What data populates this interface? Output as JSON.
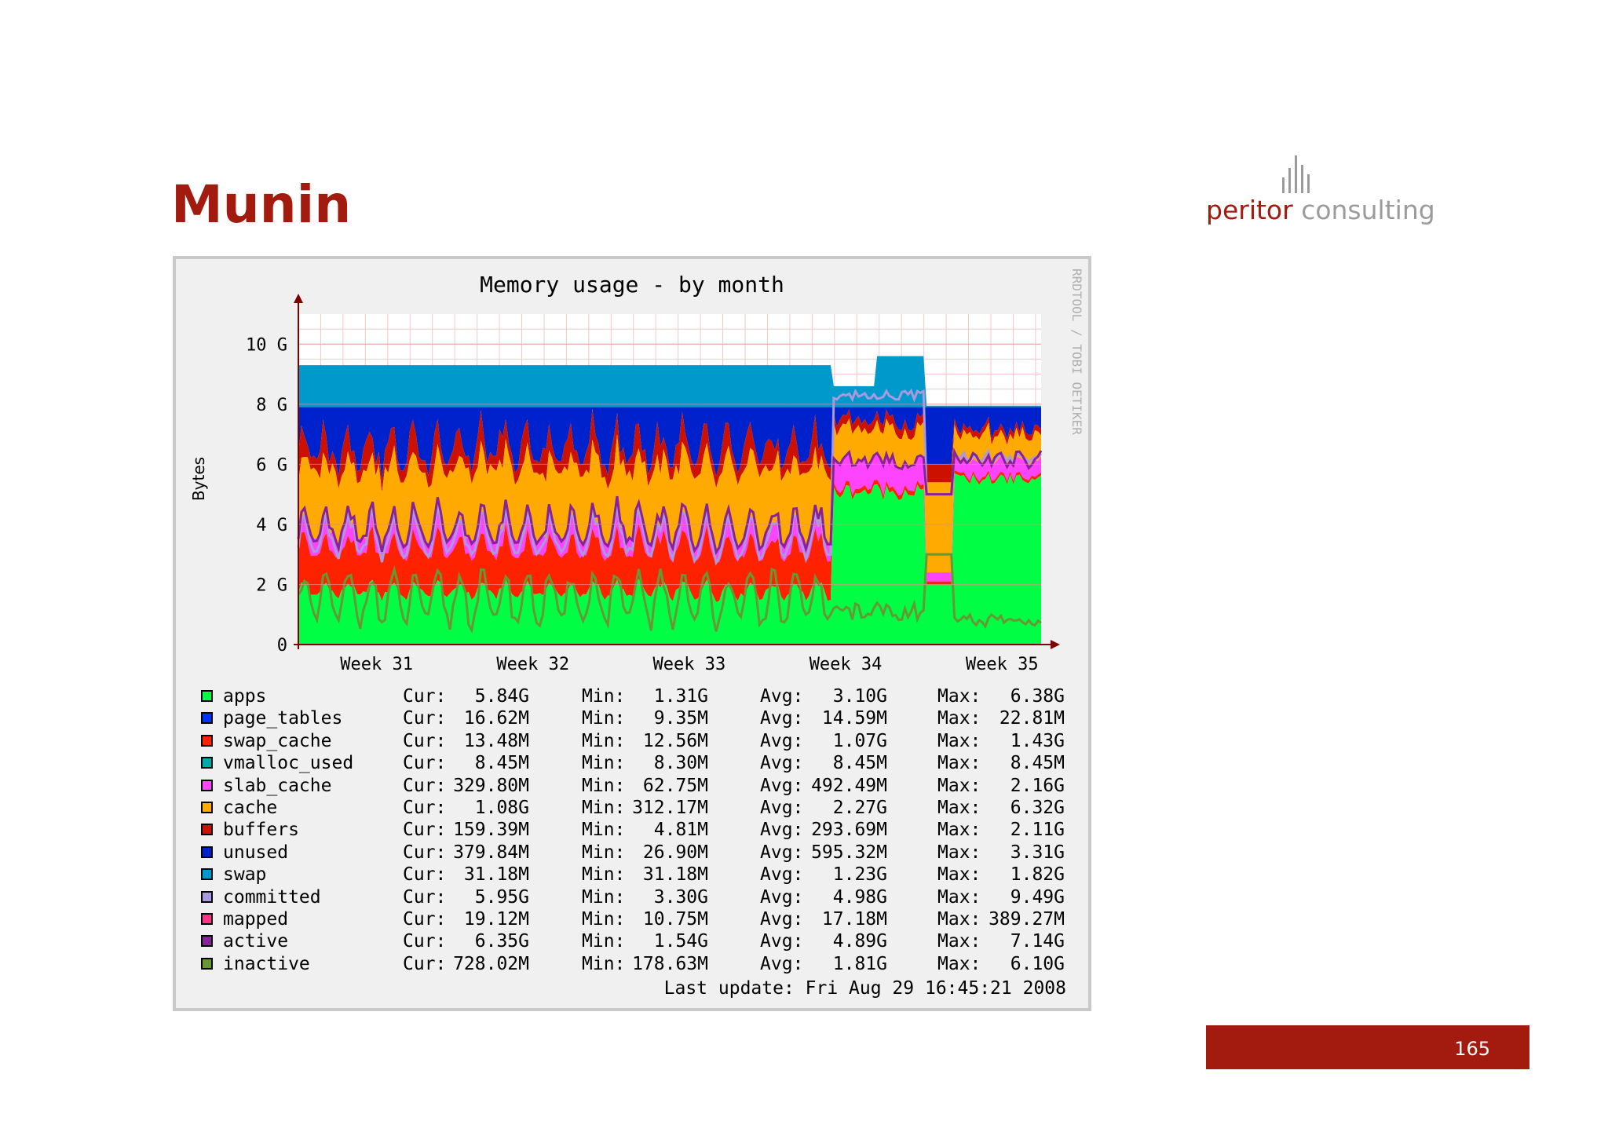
{
  "slide": {
    "title": "Munin",
    "logo": {
      "word1": "peritor",
      "word2": "consulting"
    },
    "page_number": "165"
  },
  "chart_data": {
    "type": "area",
    "title": "Memory usage - by month",
    "ylabel": "Bytes",
    "watermark": "RRDTOOL / TOBI OETIKER",
    "x_ticks": [
      "Week 31",
      "Week 32",
      "Week 33",
      "Week 34",
      "Week 35"
    ],
    "y_ticks": [
      "0",
      "2 G",
      "4 G",
      "6 G",
      "8 G",
      "10 G"
    ],
    "ylim_gb": [
      0,
      11
    ],
    "grid": true,
    "series": [
      {
        "name": "apps",
        "color": "#00ff44",
        "cur": "5.84G",
        "min": "1.31G",
        "avg": "3.10G",
        "max": "6.38G"
      },
      {
        "name": "page_tables",
        "color": "#0033ff",
        "cur": "16.62M",
        "min": "9.35M",
        "avg": "14.59M",
        "max": "22.81M"
      },
      {
        "name": "swap_cache",
        "color": "#ff2200",
        "cur": "13.48M",
        "min": "12.56M",
        "avg": "1.07G",
        "max": "1.43G"
      },
      {
        "name": "vmalloc_used",
        "color": "#00aaaa",
        "cur": "8.45M",
        "min": "8.30M",
        "avg": "8.45M",
        "max": "8.45M"
      },
      {
        "name": "slab_cache",
        "color": "#ff44ff",
        "cur": "329.80M",
        "min": "62.75M",
        "avg": "492.49M",
        "max": "2.16G"
      },
      {
        "name": "cache",
        "color": "#ffaa00",
        "cur": "1.08G",
        "min": "312.17M",
        "avg": "2.27G",
        "max": "6.32G"
      },
      {
        "name": "buffers",
        "color": "#cc1100",
        "cur": "159.39M",
        "min": "4.81M",
        "avg": "293.69M",
        "max": "2.11G"
      },
      {
        "name": "unused",
        "color": "#0022cc",
        "cur": "379.84M",
        "min": "26.90M",
        "avg": "595.32M",
        "max": "3.31G"
      },
      {
        "name": "swap",
        "color": "#0099cc",
        "cur": "31.18M",
        "min": "31.18M",
        "avg": "1.23G",
        "max": "1.82G"
      },
      {
        "name": "committed",
        "color": "#aa99dd",
        "cur": "5.95G",
        "min": "3.30G",
        "avg": "4.98G",
        "max": "9.49G"
      },
      {
        "name": "mapped",
        "color": "#ff3388",
        "cur": "19.12M",
        "min": "10.75M",
        "avg": "17.18M",
        "max": "389.27M"
      },
      {
        "name": "active",
        "color": "#882299",
        "cur": "6.35G",
        "min": "1.54G",
        "avg": "4.89G",
        "max": "7.14G"
      },
      {
        "name": "inactive",
        "color": "#669933",
        "cur": "728.02M",
        "min": "178.63M",
        "avg": "1.81G",
        "max": "6.10G"
      }
    ],
    "stat_labels": {
      "cur": "Cur:",
      "min": "Min:",
      "avg": "Avg:",
      "max": "Max:"
    },
    "last_update": "Last update: Fri Aug 29 16:45:21 2008"
  }
}
